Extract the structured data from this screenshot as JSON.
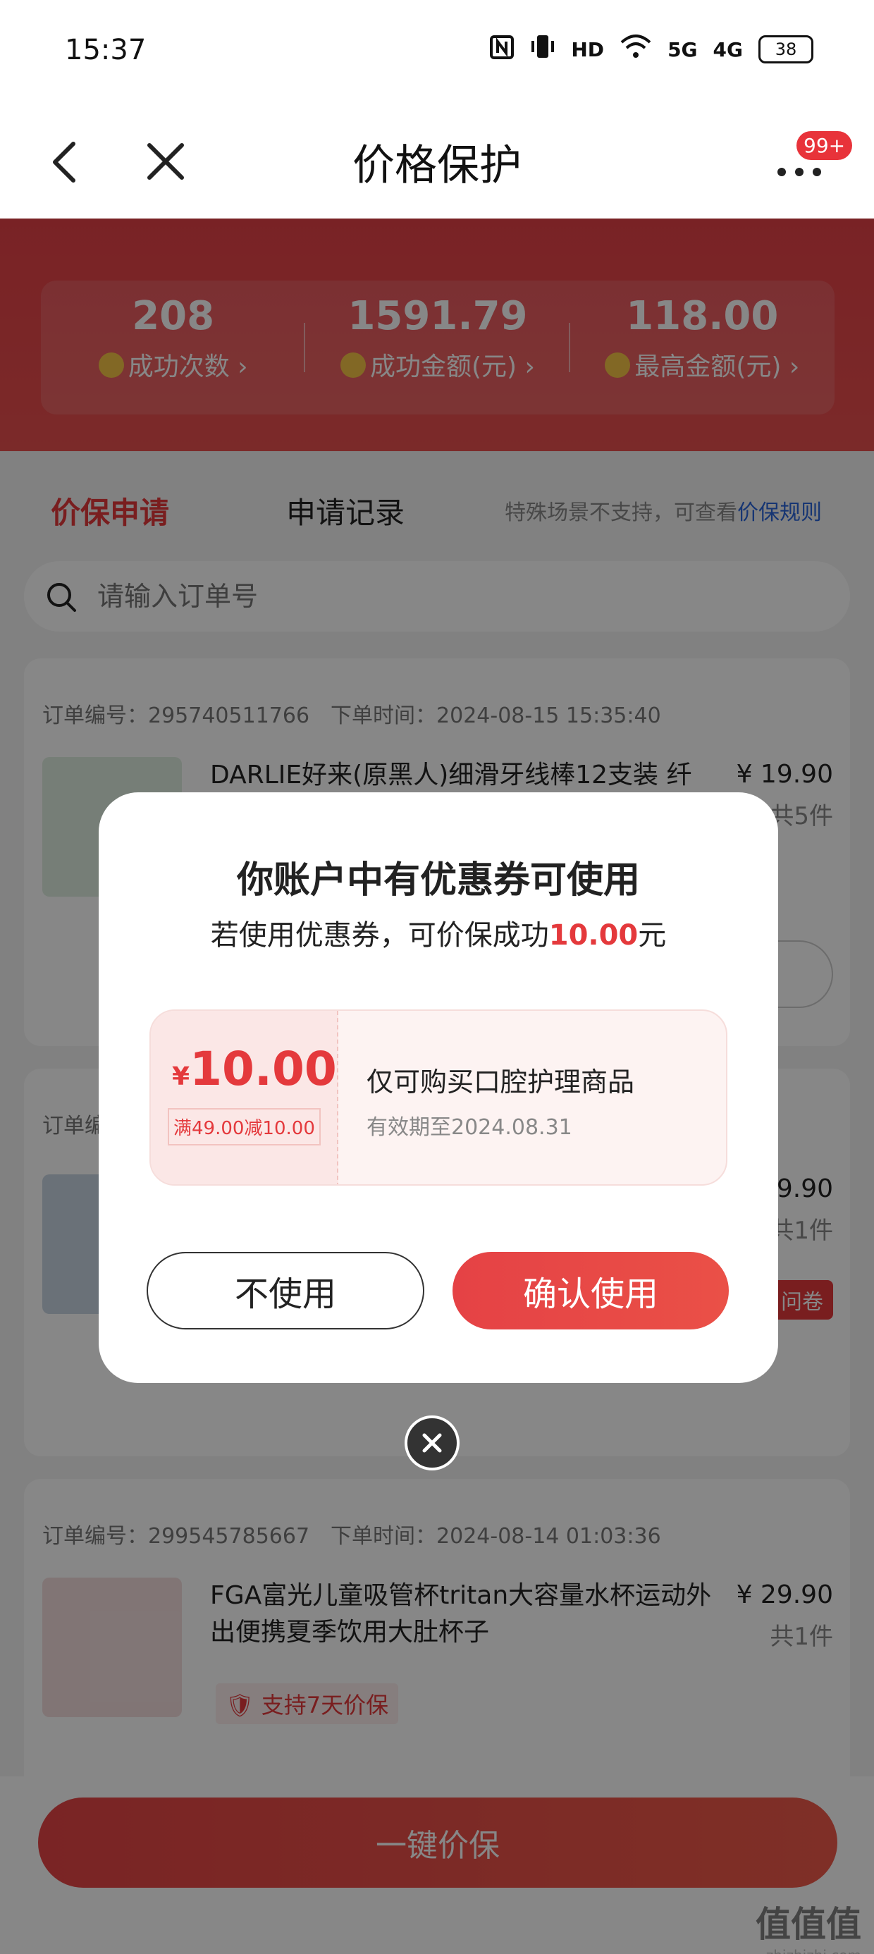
{
  "status_bar": {
    "time": "15:37",
    "icons": [
      "nfc-icon",
      "vibrate-icon",
      "hd-icon",
      "wifi-icon",
      "signal-5g-icon",
      "signal-4g-icon",
      "battery-icon"
    ],
    "hd_label": "HD",
    "net5g": "5G",
    "net4g": "4G",
    "battery": "38"
  },
  "nav": {
    "title": "价格保护",
    "badge": "99+"
  },
  "stats": [
    {
      "value": "208",
      "label": "成功次数 ›"
    },
    {
      "value": "1591.79",
      "label": "成功金额(元) ›"
    },
    {
      "value": "118.00",
      "label": "最高金额(元) ›"
    }
  ],
  "tabs": {
    "apply": "价保申请",
    "record": "申请记录",
    "note": "特殊场景不支持，可查看",
    "rules_link": "价保规则"
  },
  "search": {
    "placeholder": "请输入订单号"
  },
  "orders": [
    {
      "order_no": "订单编号：295740511766",
      "time": "下单时间：2024-08-15 15:35:40",
      "title": "DARLIE好来(原黑人)细滑牙线棒12支装 纤",
      "price": "¥ 19.90",
      "qty": "共5件"
    },
    {
      "order_no": "订单编",
      "price": "9.90",
      "qty": "共1件",
      "tag": "问卷"
    },
    {
      "order_no": "订单编号：299545785667",
      "time": "下单时间：2024-08-14 01:03:36",
      "title": "FGA富光儿童吸管杯tritan大容量水杯运动外出便携夏季饮用大肚杯子",
      "price": "¥ 29.90",
      "qty": "共1件",
      "tag": "支持7天价保"
    }
  ],
  "bottom": {
    "one_key": "一键价保"
  },
  "watermark": {
    "big": "值值值",
    "small": "zhizhizhi.com"
  },
  "modal": {
    "title": "你账户中有优惠券可使用",
    "sub_prefix": "若使用优惠券，可价保成功",
    "sub_amount": "10.00",
    "sub_suffix": "元",
    "coupon": {
      "yen": "¥",
      "amount": "10.00",
      "condition": "满49.00减10.00",
      "desc": "仅可购买口腔护理商品",
      "expiry": "有效期至2024.08.31"
    },
    "cancel_label": "不使用",
    "confirm_label": "确认使用"
  },
  "colors": {
    "accent": "#e4393c",
    "link": "#2a65d9"
  }
}
